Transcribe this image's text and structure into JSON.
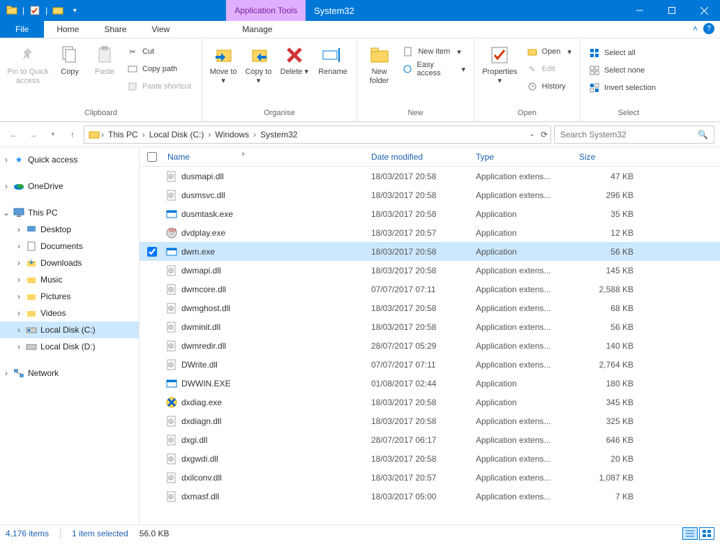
{
  "window": {
    "title": "System32",
    "context_tab": "Application Tools"
  },
  "tabs": {
    "file": "File",
    "home": "Home",
    "share": "Share",
    "view": "View",
    "manage": "Manage"
  },
  "ribbon": {
    "clipboard": {
      "label": "Clipboard",
      "pin": "Pin to Quick access",
      "copy": "Copy",
      "paste": "Paste",
      "cut": "Cut",
      "copy_path": "Copy path",
      "paste_shortcut": "Paste shortcut"
    },
    "organise": {
      "label": "Organise",
      "move_to": "Move to",
      "copy_to": "Copy to",
      "delete": "Delete",
      "rename": "Rename"
    },
    "new": {
      "label": "New",
      "new_folder": "New folder",
      "new_item": "New item",
      "easy_access": "Easy access"
    },
    "open": {
      "label": "Open",
      "properties": "Properties",
      "open": "Open",
      "edit": "Edit",
      "history": "History"
    },
    "select": {
      "label": "Select",
      "select_all": "Select all",
      "select_none": "Select none",
      "invert": "Invert selection"
    }
  },
  "breadcrumb": [
    "This PC",
    "Local Disk (C:)",
    "Windows",
    "System32"
  ],
  "search_placeholder": "Search System32",
  "nav": {
    "quick_access": "Quick access",
    "onedrive": "OneDrive",
    "this_pc": "This PC",
    "desktop": "Desktop",
    "documents": "Documents",
    "downloads": "Downloads",
    "music": "Music",
    "pictures": "Pictures",
    "videos": "Videos",
    "local_c": "Local Disk (C:)",
    "local_d": "Local Disk (D:)",
    "network": "Network"
  },
  "columns": {
    "name": "Name",
    "date": "Date modified",
    "type": "Type",
    "size": "Size"
  },
  "files": [
    {
      "name": "dusmapi.dll",
      "date": "18/03/2017 20:58",
      "type": "Application extens...",
      "size": "47 KB",
      "icon": "dll",
      "selected": false
    },
    {
      "name": "dusmsvc.dll",
      "date": "18/03/2017 20:58",
      "type": "Application extens...",
      "size": "296 KB",
      "icon": "dll",
      "selected": false
    },
    {
      "name": "dusmtask.exe",
      "date": "18/03/2017 20:58",
      "type": "Application",
      "size": "35 KB",
      "icon": "exe",
      "selected": false
    },
    {
      "name": "dvdplay.exe",
      "date": "18/03/2017 20:57",
      "type": "Application",
      "size": "12 KB",
      "icon": "dvd",
      "selected": false
    },
    {
      "name": "dwm.exe",
      "date": "18/03/2017 20:58",
      "type": "Application",
      "size": "56 KB",
      "icon": "exe",
      "selected": true
    },
    {
      "name": "dwmapi.dll",
      "date": "18/03/2017 20:58",
      "type": "Application extens...",
      "size": "145 KB",
      "icon": "dll",
      "selected": false
    },
    {
      "name": "dwmcore.dll",
      "date": "07/07/2017 07:11",
      "type": "Application extens...",
      "size": "2,588 KB",
      "icon": "dll",
      "selected": false
    },
    {
      "name": "dwmghost.dll",
      "date": "18/03/2017 20:58",
      "type": "Application extens...",
      "size": "68 KB",
      "icon": "dll",
      "selected": false
    },
    {
      "name": "dwminit.dll",
      "date": "18/03/2017 20:58",
      "type": "Application extens...",
      "size": "56 KB",
      "icon": "dll",
      "selected": false
    },
    {
      "name": "dwmredir.dll",
      "date": "28/07/2017 05:29",
      "type": "Application extens...",
      "size": "140 KB",
      "icon": "dll",
      "selected": false
    },
    {
      "name": "DWrite.dll",
      "date": "07/07/2017 07:11",
      "type": "Application extens...",
      "size": "2,764 KB",
      "icon": "dll",
      "selected": false
    },
    {
      "name": "DWWIN.EXE",
      "date": "01/08/2017 02:44",
      "type": "Application",
      "size": "180 KB",
      "icon": "exe",
      "selected": false
    },
    {
      "name": "dxdiag.exe",
      "date": "18/03/2017 20:58",
      "type": "Application",
      "size": "345 KB",
      "icon": "dxdiag",
      "selected": false
    },
    {
      "name": "dxdiagn.dll",
      "date": "18/03/2017 20:58",
      "type": "Application extens...",
      "size": "325 KB",
      "icon": "dll",
      "selected": false
    },
    {
      "name": "dxgi.dll",
      "date": "28/07/2017 06:17",
      "type": "Application extens...",
      "size": "646 KB",
      "icon": "dll",
      "selected": false
    },
    {
      "name": "dxgwdi.dll",
      "date": "18/03/2017 20:58",
      "type": "Application extens...",
      "size": "20 KB",
      "icon": "dll",
      "selected": false
    },
    {
      "name": "dxilconv.dll",
      "date": "18/03/2017 20:57",
      "type": "Application extens...",
      "size": "1,087 KB",
      "icon": "dll",
      "selected": false
    },
    {
      "name": "dxmasf.dll",
      "date": "18/03/2017 05:00",
      "type": "Application extens...",
      "size": "7 KB",
      "icon": "dll",
      "selected": false
    }
  ],
  "status": {
    "items": "4,176 items",
    "selected": "1 item selected",
    "size": "56.0 KB"
  }
}
